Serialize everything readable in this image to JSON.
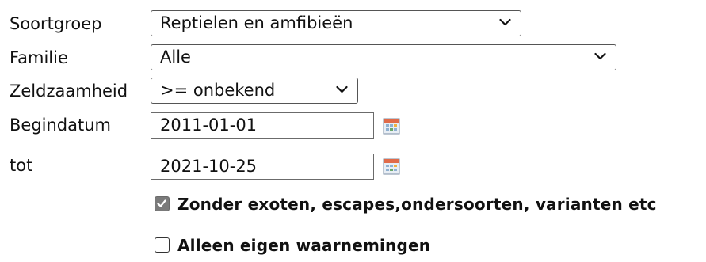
{
  "form": {
    "soortgroep": {
      "label": "Soortgroep",
      "value": "Reptielen en amfibieën"
    },
    "familie": {
      "label": "Familie",
      "value": "Alle"
    },
    "zeldzaamheid": {
      "label": "Zeldzaamheid",
      "value": ">= onbekend"
    },
    "begindatum": {
      "label": "Begindatum",
      "value": "2011-01-01"
    },
    "einddatum": {
      "label": "tot",
      "value": "2021-10-25"
    },
    "zonder_exoten": {
      "label": "Zonder exoten, escapes,ondersoorten, varianten etc",
      "checked": true
    },
    "alleen_eigen": {
      "label": "Alleen eigen waarnemingen",
      "checked": false
    }
  },
  "icons": {
    "dropdown": "chevron-down-icon",
    "date_picker": "calendar-icon",
    "checkmark": "checkmark-icon"
  }
}
